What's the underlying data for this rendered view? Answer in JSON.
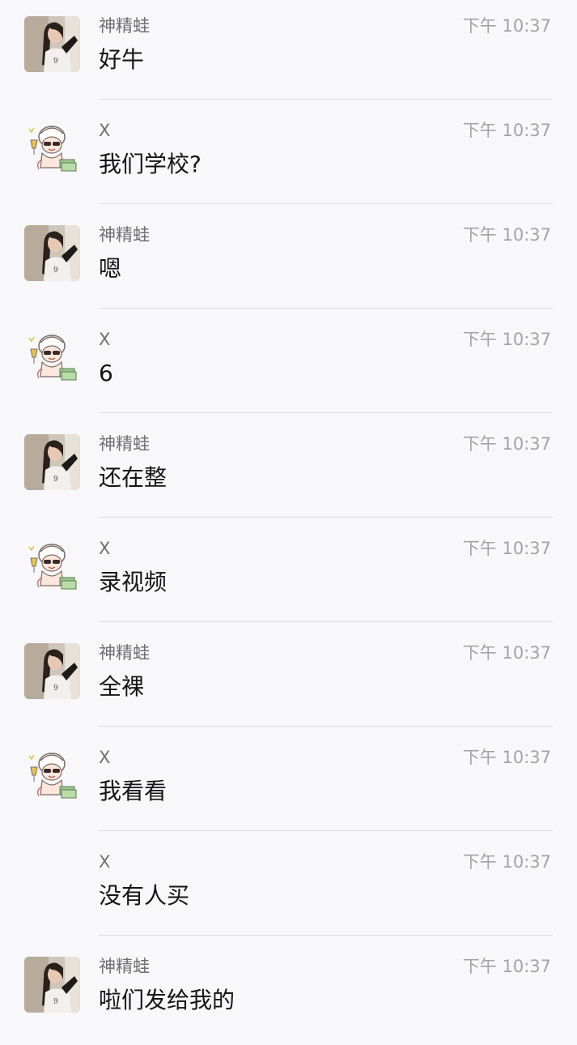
{
  "messages": [
    {
      "sender": "神精蛙",
      "time": "下午 10:37",
      "text": "好牛",
      "avatar": "girl-photo"
    },
    {
      "sender": "X",
      "time": "下午 10:37",
      "text": "我们学校?",
      "avatar": "cartoon-baby"
    },
    {
      "sender": "神精蛙",
      "time": "下午 10:37",
      "text": "嗯",
      "avatar": "girl-photo"
    },
    {
      "sender": "X",
      "time": "下午 10:37",
      "text": "6",
      "avatar": "cartoon-baby"
    },
    {
      "sender": "神精蛙",
      "time": "下午 10:37",
      "text": "还在整",
      "avatar": "girl-photo"
    },
    {
      "sender": "X",
      "time": "下午 10:37",
      "text": "录视频",
      "avatar": "cartoon-baby"
    },
    {
      "sender": "神精蛙",
      "time": "下午 10:37",
      "text": "全裸",
      "avatar": "girl-photo"
    },
    {
      "sender": "X",
      "time": "下午 10:37",
      "text": "我看看",
      "avatar": "cartoon-baby"
    },
    {
      "sender": "X",
      "time": "下午 10:37",
      "text": "没有人买",
      "avatar": ""
    },
    {
      "sender": "神精蛙",
      "time": "下午 10:37",
      "text": "啦们发给我的",
      "avatar": "girl-photo"
    }
  ]
}
